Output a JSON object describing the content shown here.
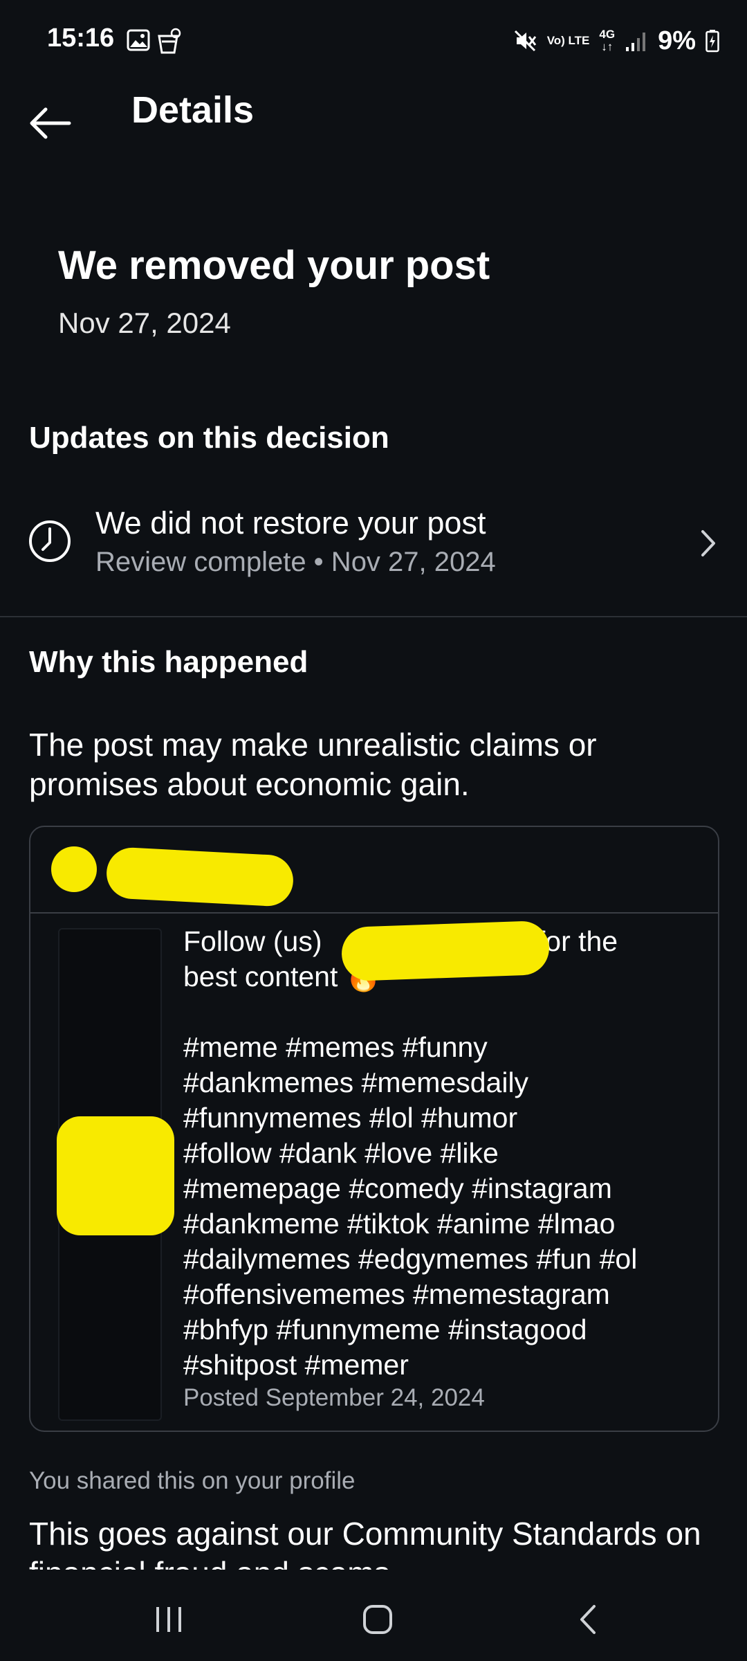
{
  "status_bar": {
    "time": "15:16",
    "icons": [
      "gallery-icon",
      "alarm-icon",
      "mute-icon",
      "volte-icon",
      "4g-icon",
      "signal-icon",
      "battery-icon"
    ],
    "volte_label": "Vo) LTE",
    "network_label": "4G",
    "battery": "9%"
  },
  "header": {
    "title": "Details"
  },
  "removal": {
    "title": "We removed your post",
    "date": "Nov 27, 2024"
  },
  "updates": {
    "heading": "Updates on this decision",
    "item": {
      "title": "We did not restore your post",
      "subtitle": "Review complete • Nov 27, 2024"
    }
  },
  "why": {
    "heading": "Why this happened",
    "reason": "The post may make unrealistic claims or promises about economic gain."
  },
  "post": {
    "caption_line1": "Follow (us) ",
    "caption_line1_end": "for the",
    "caption_line2": "best content 🔥",
    "hashtags": "#meme #memes #funny\n#dankmemes #memesdaily\n#funnymemes #lol #humor\n#follow #dank #love #like\n#memepage #comedy #instagram\n#dankmeme #tiktok #anime #lmao\n#dailymemes #edgymemes #fun #ol\n#offensivememes #memestagram\n#bhfyp #funnymeme #instagood\n#shitpost #memer",
    "posted": "Posted September 24, 2024"
  },
  "shared_note": "You shared this on your profile",
  "standards": "This goes against our Community Standards on financial fraud and scams.",
  "colors": {
    "background": "#0d1014",
    "secondary_text": "#a9adb4",
    "redaction": "#f8ea00",
    "border": "#3a3e45"
  }
}
